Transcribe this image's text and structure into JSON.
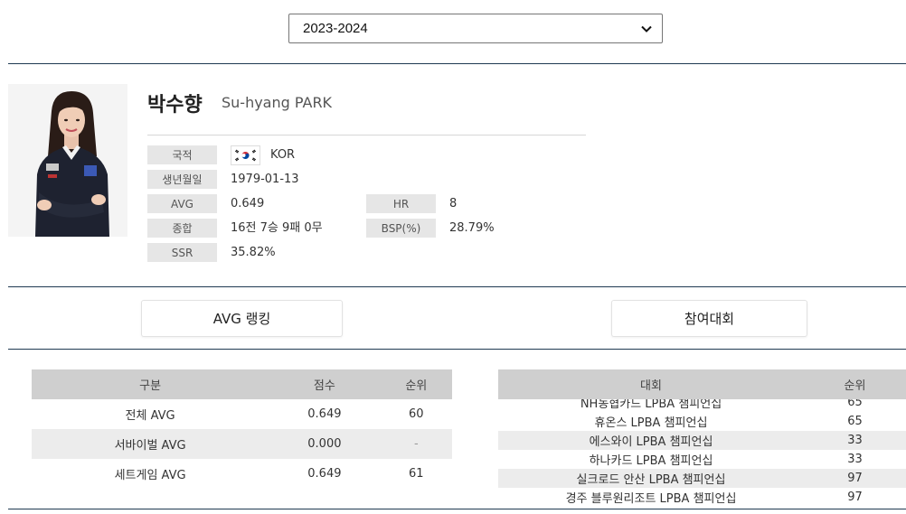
{
  "season": {
    "selected": "2023-2024"
  },
  "player": {
    "name_ko": "박수향",
    "name_en": "Su-hyang PARK",
    "labels": {
      "nationality": "국적",
      "birth": "생년월일",
      "avg": "AVG",
      "hr": "HR",
      "total": "종합",
      "bsp": "BSP(%)",
      "ssr": "SSR"
    },
    "values": {
      "nationality": "KOR",
      "birth": "1979-01-13",
      "avg": "0.649",
      "hr": "8",
      "total": "16전 7승 9패 0무",
      "bsp": "28.79%",
      "ssr": "35.82%"
    },
    "flag_icon": "korea-flag-icon"
  },
  "tabs": {
    "avg_ranking": "AVG 랭킹",
    "tournaments": "참여대회"
  },
  "avg_table": {
    "headers": [
      "구분",
      "점수",
      "순위"
    ],
    "rows": [
      [
        "전체 AVG",
        "0.649",
        "60"
      ],
      [
        "서바이벌 AVG",
        "0.000",
        "-"
      ],
      [
        "세트게임 AVG",
        "0.649",
        "61"
      ]
    ]
  },
  "tournament_table": {
    "headers": [
      "대회",
      "순위"
    ],
    "rows": [
      [
        "NH농협카드 LPBA 챔피언십",
        "65"
      ],
      [
        "휴온스 LPBA 챔피언십",
        "65"
      ],
      [
        "에스와이 LPBA 챔피언십",
        "33"
      ],
      [
        "하나카드 LPBA 챔피언십",
        "33"
      ],
      [
        "실크로드 안산 LPBA 챔피언십",
        "97"
      ],
      [
        "경주 블루원리조트 LPBA 챔피언십",
        "97"
      ]
    ]
  },
  "colors": {
    "divider": "#1f3a52",
    "header_bg": "#cfcfcf",
    "label_bg": "#e6e6e6"
  }
}
